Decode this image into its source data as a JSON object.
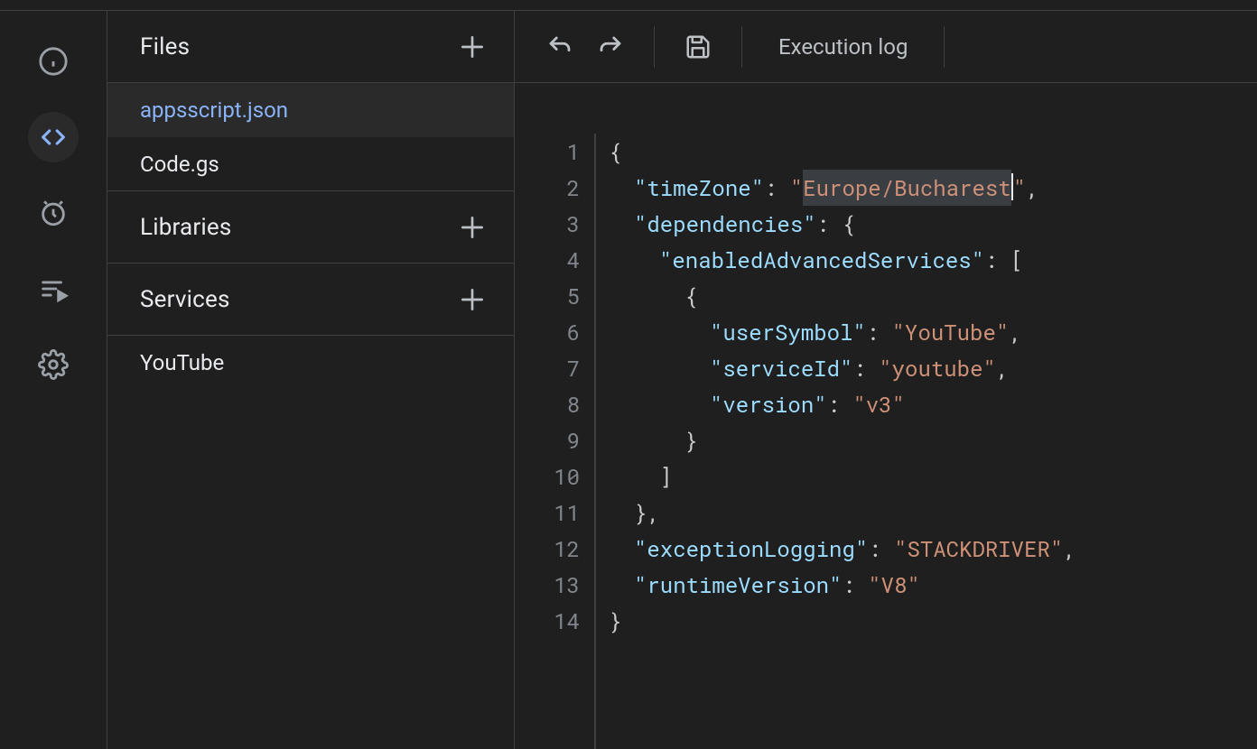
{
  "sidebar": {
    "files_header": "Files",
    "libraries_header": "Libraries",
    "services_header": "Services",
    "files": [
      {
        "name": "appsscript.json",
        "active": true
      },
      {
        "name": "Code.gs",
        "active": false
      }
    ],
    "services": [
      {
        "name": "YouTube"
      }
    ]
  },
  "toolbar": {
    "execution_log": "Execution log"
  },
  "editor": {
    "filename": "appsscript.json",
    "content_raw": "{\n  \"timeZone\": \"Europe/Bucharest\",\n  \"dependencies\": {\n    \"enabledAdvancedServices\": [\n      {\n        \"userSymbol\": \"YouTube\",\n        \"serviceId\": \"youtube\",\n        \"version\": \"v3\"\n      }\n    ]\n  },\n  \"exceptionLogging\": \"STACKDRIVER\",\n  \"runtimeVersion\": \"V8\"\n}",
    "content_json": {
      "timeZone": "Europe/Bucharest",
      "dependencies": {
        "enabledAdvancedServices": [
          {
            "userSymbol": "YouTube",
            "serviceId": "youtube",
            "version": "v3"
          }
        ]
      },
      "exceptionLogging": "STACKDRIVER",
      "runtimeVersion": "V8"
    },
    "line_numbers": [
      "1",
      "2",
      "3",
      "4",
      "5",
      "6",
      "7",
      "8",
      "9",
      "10",
      "11",
      "12",
      "13",
      "14"
    ],
    "tokens": {
      "l1": [
        [
          "{",
          "p"
        ]
      ],
      "l2": [
        [
          "\"timeZone\"",
          "k"
        ],
        [
          ": ",
          "p"
        ],
        [
          "\"",
          "s"
        ],
        [
          "Europe/Bucharest",
          "s hl"
        ],
        [
          "\"",
          "s"
        ],
        [
          ",",
          "p"
        ]
      ],
      "l3": [
        [
          "\"dependencies\"",
          "k"
        ],
        [
          ": {",
          "p"
        ]
      ],
      "l4": [
        [
          "\"enabledAdvancedServices\"",
          "k"
        ],
        [
          ": [",
          "p"
        ]
      ],
      "l5": [
        [
          "{",
          "p"
        ]
      ],
      "l6": [
        [
          "\"userSymbol\"",
          "k"
        ],
        [
          ": ",
          "p"
        ],
        [
          "\"YouTube\"",
          "s"
        ],
        [
          ",",
          "p"
        ]
      ],
      "l7": [
        [
          "\"serviceId\"",
          "k"
        ],
        [
          ": ",
          "p"
        ],
        [
          "\"youtube\"",
          "s"
        ],
        [
          ",",
          "p"
        ]
      ],
      "l8": [
        [
          "\"version\"",
          "k"
        ],
        [
          ": ",
          "p"
        ],
        [
          "\"v3\"",
          "s"
        ]
      ],
      "l9": [
        [
          "}",
          "p"
        ]
      ],
      "l10": [
        [
          "]",
          "p"
        ]
      ],
      "l11": [
        [
          "},",
          "p"
        ]
      ],
      "l12": [
        [
          "\"exceptionLogging\"",
          "k"
        ],
        [
          ": ",
          "p"
        ],
        [
          "\"STACKDRIVER\"",
          "s"
        ],
        [
          ",",
          "p"
        ]
      ],
      "l13": [
        [
          "\"runtimeVersion\"",
          "k"
        ],
        [
          ": ",
          "p"
        ],
        [
          "\"V8\"",
          "s"
        ]
      ],
      "l14": [
        [
          "}",
          "p"
        ]
      ]
    },
    "indent": {
      "l1": 0,
      "l2": 1,
      "l3": 1,
      "l4": 2,
      "l5": 3,
      "l6": 4,
      "l7": 4,
      "l8": 4,
      "l9": 3,
      "l10": 2,
      "l11": 1,
      "l12": 1,
      "l13": 1,
      "l14": 0
    },
    "cursor_line": 2,
    "colors": {
      "key": "#9cdcfe",
      "string": "#ce9178",
      "punct": "#cccccc",
      "bg": "#1f1f1f",
      "accent": "#8ab4f8"
    }
  }
}
